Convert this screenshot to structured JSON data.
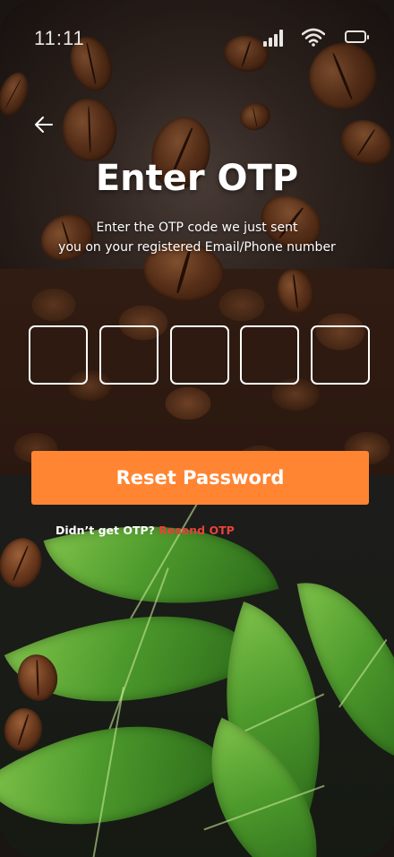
{
  "status_bar": {
    "time": "11:11"
  },
  "header": {
    "title": "Enter OTP",
    "subtitle_line1": "Enter the OTP code we just sent",
    "subtitle_line2": "you on your registered Email/Phone number"
  },
  "otp": {
    "boxes": [
      "",
      "",
      "",
      "",
      ""
    ]
  },
  "actions": {
    "reset_label": "Reset Password",
    "resend_prompt": "Didn’t get OTP?",
    "resend_link": "Resend OTP"
  },
  "colors": {
    "accent": "#ff8533",
    "link": "#e8423a",
    "text": "#ffffff"
  },
  "icons": {
    "back": "arrow-left-icon",
    "signal": "signal-icon",
    "wifi": "wifi-icon",
    "battery": "battery-icon"
  }
}
